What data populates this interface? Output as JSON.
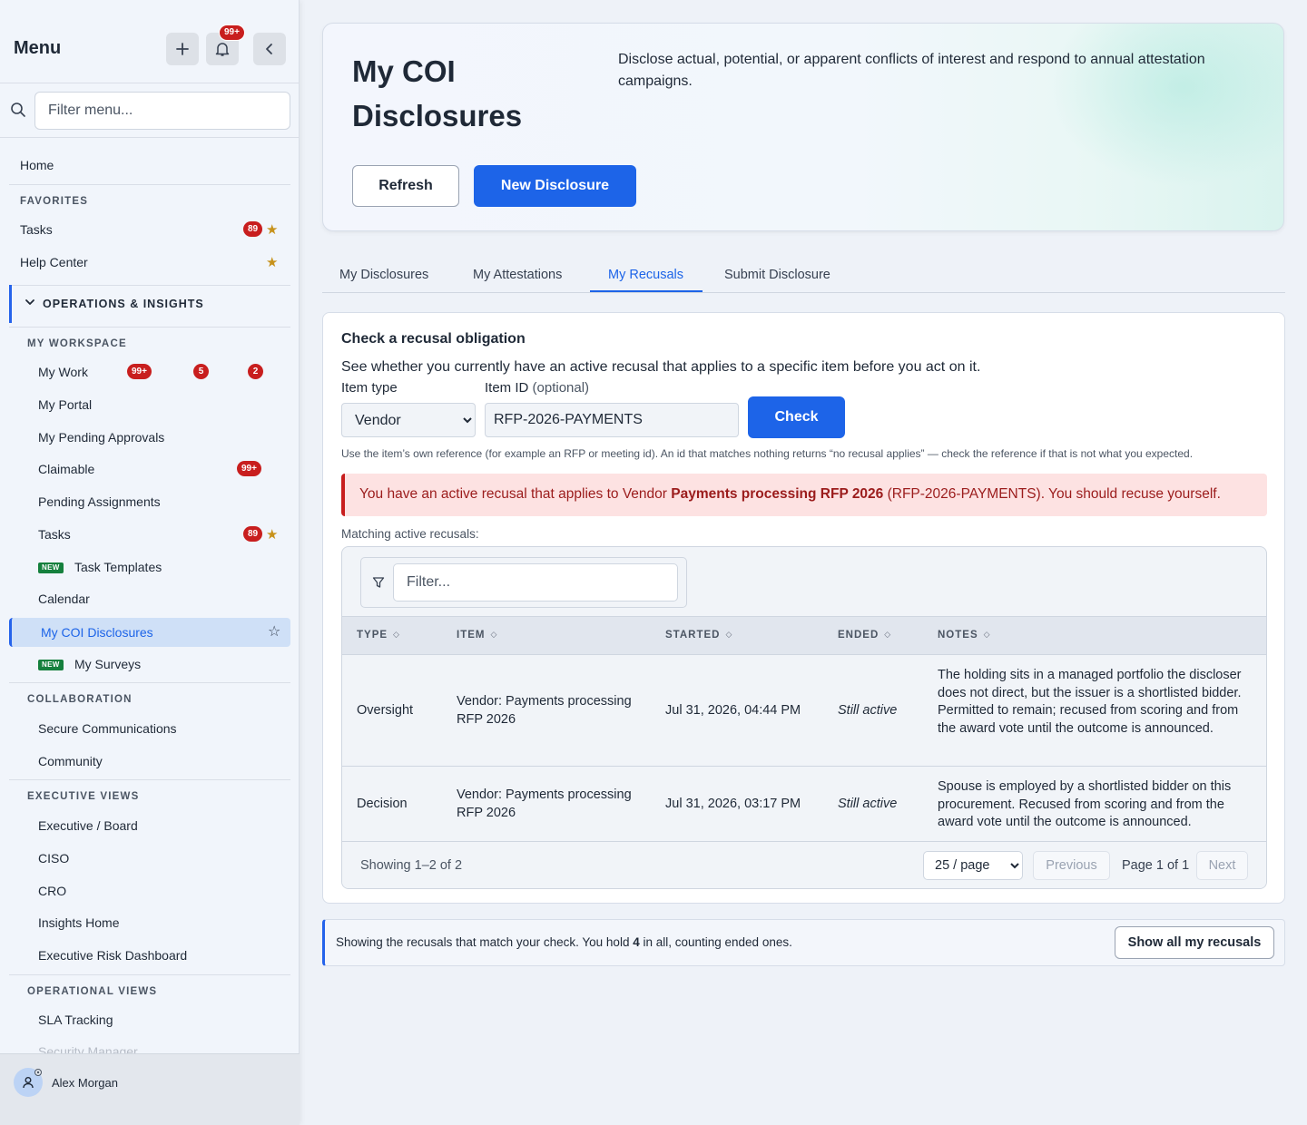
{
  "sidebar": {
    "title": "Menu",
    "notifications_badge": "99+",
    "filter_placeholder": "Filter menu...",
    "home": "Home",
    "favorites_heading": "FAVORITES",
    "favorites": [
      {
        "label": "Tasks",
        "badge": "89",
        "starred": true
      },
      {
        "label": "Help Center",
        "starred": true
      }
    ],
    "group_heading": "OPERATIONS & INSIGHTS",
    "my_workspace_heading": "MY WORKSPACE",
    "my_workspace": [
      {
        "label": "My Work",
        "badges": [
          "99+",
          "5",
          "2"
        ]
      },
      {
        "label": "My Portal"
      },
      {
        "label": "My Pending Approvals"
      },
      {
        "label": "Claimable",
        "badge": "99+"
      },
      {
        "label": "Pending Assignments"
      },
      {
        "label": "Tasks",
        "badge": "89",
        "starred": true
      },
      {
        "label": "Task Templates",
        "tag": "NEW"
      },
      {
        "label": "Calendar"
      },
      {
        "label": "My COI Disclosures",
        "active": true
      },
      {
        "label": "My Surveys",
        "tag": "NEW"
      }
    ],
    "collaboration_heading": "COLLABORATION",
    "collaboration": [
      "Secure Communications",
      "Community"
    ],
    "executive_heading": "EXECUTIVE VIEWS",
    "executive": [
      "Executive / Board",
      "CISO",
      "CRO",
      "Insights Home",
      "Executive Risk Dashboard"
    ],
    "operational_heading": "OPERATIONAL VIEWS",
    "operational": [
      "SLA Tracking",
      "Security Manager"
    ],
    "user_name": "Alex Morgan"
  },
  "hero": {
    "title": "My COI Disclosures",
    "description": "Disclose actual, potential, or apparent conflicts of interest and respond to annual attestation campaigns.",
    "refresh_label": "Refresh",
    "new_label": "New Disclosure"
  },
  "tabs": [
    "My Disclosures",
    "My Attestations",
    "My Recusals",
    "Submit Disclosure"
  ],
  "active_tab": "My Recusals",
  "check": {
    "title": "Check a recusal obligation",
    "description": "See whether you currently have an active recusal that applies to a specific item before you act on it.",
    "item_type_label": "Item type",
    "item_type_value": "Vendor",
    "item_id_label": "Item ID",
    "item_id_optional": "(optional)",
    "item_id_value": "RFP-2026-PAYMENTS",
    "check_label": "Check",
    "hint": "Use the item’s own reference (for example an RFP or meeting id). An id that matches nothing returns “no recusal applies” — check the reference if that is not what you expected.",
    "alert_prefix": "You have an active recusal that applies to Vendor ",
    "alert_item": "Payments processing RFP 2026",
    "alert_suffix": " (RFP-2026-PAYMENTS). You should recuse yourself.",
    "matching_label": "Matching active recusals:"
  },
  "table": {
    "filter_placeholder": "Filter...",
    "columns": [
      "TYPE",
      "ITEM",
      "STARTED",
      "ENDED",
      "NOTES"
    ],
    "rows": [
      {
        "type": "Oversight",
        "item": "Vendor: Payments processing RFP 2026",
        "started": "Jul 31, 2026, 04:44 PM",
        "ended": "Still active",
        "notes": "The holding sits in a managed portfolio the discloser does not direct, but the issuer is a shortlisted bidder. Permitted to remain; recused from scoring and from the award vote until the outcome is announced."
      },
      {
        "type": "Decision",
        "item": "Vendor: Payments processing RFP 2026",
        "started": "Jul 31, 2026, 03:17 PM",
        "ended": "Still active",
        "notes": "Spouse is employed by a shortlisted bidder on this procurement. Recused from scoring and from the award vote until the outcome is announced."
      }
    ],
    "showing": "Showing 1–2 of 2",
    "per_page": "25 / page",
    "previous": "Previous",
    "page_info": "Page 1 of 1",
    "next": "Next"
  },
  "info": {
    "text_before": "Showing the recusals that match your check. You hold ",
    "count": "4",
    "text_after": " in all, counting ended ones.",
    "button": "Show all my recusals"
  },
  "colors": {
    "accent": "#1d64e8",
    "danger": "#c81e1e",
    "new_tag": "#15803d",
    "star": "#c7921b"
  }
}
